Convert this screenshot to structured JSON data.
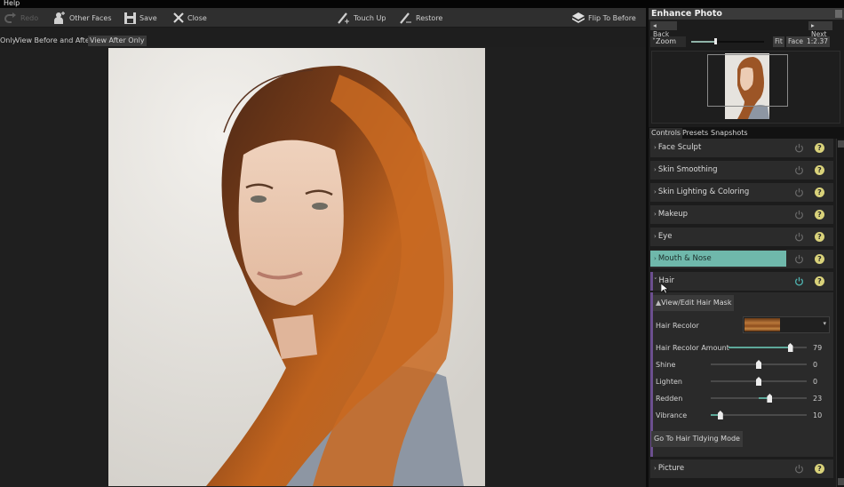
{
  "menubar": {
    "help": "Help"
  },
  "toolbar": {
    "redo": "Redo",
    "other_faces": "Other Faces",
    "save": "Save",
    "close": "Close",
    "touch_up": "Touch Up",
    "restore": "Restore",
    "flip_to_before": "Flip To Before"
  },
  "view_options": {
    "before_only": "Only",
    "before_and_after": "View Before and After",
    "after_only": "View After Only",
    "active": "View After Only"
  },
  "panel": {
    "title": "Enhance Photo",
    "back": "Back",
    "next": "Next",
    "zoom": {
      "label": "Zoom",
      "fit": "Fit",
      "face": "Face",
      "ratio": "1:2.37",
      "slider_fraction": 0.33
    },
    "tabs": [
      "Controls",
      "Presets",
      "Snapshots"
    ],
    "active_tab": "Controls",
    "sections": [
      {
        "label": "Face Sculpt",
        "expanded": false,
        "enabled": false
      },
      {
        "label": "Skin Smoothing",
        "expanded": false,
        "enabled": false
      },
      {
        "label": "Skin Lighting & Coloring",
        "expanded": false,
        "enabled": false
      },
      {
        "label": "Makeup",
        "expanded": false,
        "enabled": false
      },
      {
        "label": "Eye",
        "expanded": false,
        "enabled": false
      },
      {
        "label": "Mouth & Nose",
        "expanded": false,
        "enabled": false,
        "highlighted": true
      },
      {
        "label": "Hair",
        "expanded": true,
        "enabled": true
      },
      {
        "label": "Picture",
        "expanded": false,
        "enabled": false
      }
    ],
    "hair": {
      "view_edit_mask": "View/Edit Hair Mask",
      "recolor_label": "Hair Recolor",
      "controls": [
        {
          "label": "Hair Recolor Amount",
          "value": "79",
          "min": 0,
          "max": 100
        },
        {
          "label": "Shine",
          "value": "0",
          "min": -100,
          "max": 100
        },
        {
          "label": "Lighten",
          "value": "0",
          "min": -100,
          "max": 100
        },
        {
          "label": "Redden",
          "value": "23",
          "min": -100,
          "max": 100
        },
        {
          "label": "Vibrance",
          "value": "10",
          "min": 0,
          "max": 100
        }
      ],
      "tidying_mode": "Go To Hair Tidying Mode"
    },
    "help_glyph": "?"
  },
  "colors": {
    "highlight": "#6fb8ab",
    "power_on": "#4fb3b0",
    "help": "#d9d27a",
    "hair_accent": "#6c4f8f"
  }
}
